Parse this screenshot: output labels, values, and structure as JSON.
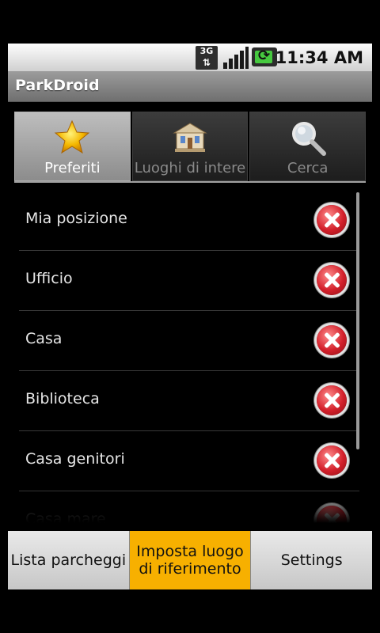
{
  "status_bar": {
    "time": "11:34 AM",
    "network": "3G",
    "signal_icon": "signal-icon",
    "battery_icon": "battery-charging-icon"
  },
  "app": {
    "title": "ParkDroid"
  },
  "tabs": [
    {
      "label": "Preferiti",
      "icon": "star-icon",
      "selected": true
    },
    {
      "label": "Luoghi di intere",
      "icon": "building-icon",
      "selected": false
    },
    {
      "label": "Cerca",
      "icon": "search-icon",
      "selected": false
    }
  ],
  "favorites": [
    {
      "name": "Mia posizione"
    },
    {
      "name": "Ufficio"
    },
    {
      "name": "Casa"
    },
    {
      "name": "Biblioteca"
    },
    {
      "name": "Casa genitori"
    },
    {
      "name": "Casa mare"
    }
  ],
  "bottom_buttons": {
    "lista": "Lista parcheggi",
    "imposta": "Imposta luogo di riferimento",
    "settings": "Settings"
  },
  "colors": {
    "accent": "#f7b000",
    "delete": "#d3202b"
  }
}
